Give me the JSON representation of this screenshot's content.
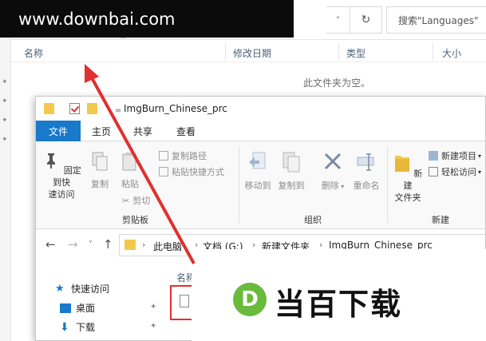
{
  "watermark": {
    "site": "www.downbai.com",
    "logo_letter": "D",
    "logo_text": "当百下载"
  },
  "background_window": {
    "search_placeholder": "搜索\"Languages\"",
    "dropdown_icon": "˅",
    "refresh_icon": "↻",
    "columns": {
      "name": "名称",
      "modified": "修改日期",
      "type": "类型",
      "size": "大小"
    },
    "empty_message": "此文件夹为空。"
  },
  "window": {
    "title": "ImgBurn_Chinese_prc",
    "qa_separator": "="
  },
  "ribbon_tabs": {
    "file": "文件",
    "home": "主页",
    "share": "共享",
    "view": "查看"
  },
  "ribbon": {
    "clipboard": {
      "pin_quick": "固定到快\n速访问",
      "copy": "复制",
      "paste": "粘贴",
      "copy_path": "复制路径",
      "paste_shortcut": "粘贴快捷方式",
      "cut": "剪切",
      "group_label": "剪贴板"
    },
    "organize": {
      "move_to": "移动到",
      "copy_to": "复制到",
      "delete": "删除",
      "rename": "重命名",
      "group_label": "组织"
    },
    "new": {
      "new_folder": "新建\n文件夹",
      "new_item": "新建项目",
      "easy_access": "轻松访问",
      "group_label": "新建"
    }
  },
  "address": {
    "crumbs": [
      "此电脑",
      "文档 (G:)",
      "新建文件夹",
      "ImgBurn_Chinese_prc"
    ]
  },
  "nav_pane": {
    "items": [
      "快速访问",
      "桌面",
      "下载"
    ]
  },
  "content": {
    "column_name": "名称"
  },
  "colors": {
    "accent": "#1979ca",
    "arrow": "#e03030",
    "logo_green": "#6aba3c"
  }
}
